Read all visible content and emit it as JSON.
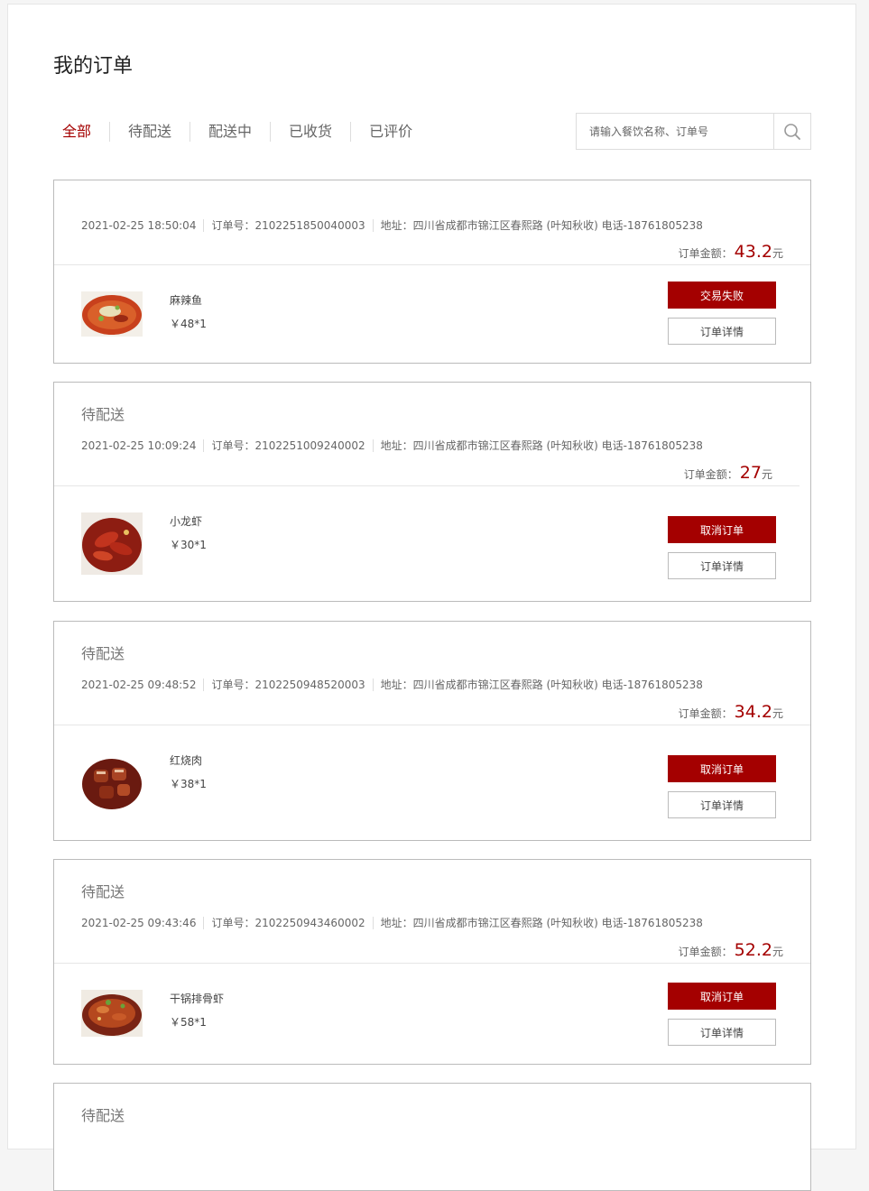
{
  "page": {
    "title": "我的订单"
  },
  "tabs": [
    "全部",
    "待配送",
    "配送中",
    "已收货",
    "已评价"
  ],
  "search": {
    "placeholder": "请输入餐饮名称、订单号",
    "icon": "search-icon"
  },
  "orders": [
    {
      "status": "",
      "datetime": "2021-02-25 18:50:04",
      "order_no": "订单号：2102251850040003",
      "address": "地址：四川省成都市锦江区春熙路 (叶知秋收) 电话-18761805238",
      "total_label": "订单金额：",
      "total": "43.2",
      "unit": "元",
      "item": {
        "name": "麻辣鱼",
        "price": "￥48*1",
        "image": "spicy-fish-dish"
      },
      "primary_button": "交易失败",
      "detail_button": "订单详情"
    },
    {
      "status": "待配送",
      "datetime": "2021-02-25 10:09:24",
      "order_no": "订单号：2102251009240002",
      "address": "地址：四川省成都市锦江区春熙路 (叶知秋收) 电话-18761805238",
      "total_label": "订单金额：",
      "total": "27",
      "unit": "元",
      "item": {
        "name": "小龙虾",
        "price": "￥30*1",
        "image": "crayfish-dish"
      },
      "primary_button": "取消订单",
      "detail_button": "订单详情"
    },
    {
      "status": "待配送",
      "datetime": "2021-02-25 09:48:52",
      "order_no": "订单号：2102250948520003",
      "address": "地址：四川省成都市锦江区春熙路 (叶知秋收) 电话-18761805238",
      "total_label": "订单金额：",
      "total": "34.2",
      "unit": "元",
      "item": {
        "name": "红烧肉",
        "price": "￥38*1",
        "image": "braised-pork-dish"
      },
      "primary_button": "取消订单",
      "detail_button": "订单详情"
    },
    {
      "status": "待配送",
      "datetime": "2021-02-25 09:43:46",
      "order_no": "订单号：2102250943460002",
      "address": "地址：四川省成都市锦江区春熙路 (叶知秋收) 电话-18761805238",
      "total_label": "订单金额：",
      "total": "52.2",
      "unit": "元",
      "item": {
        "name": "干锅排骨虾",
        "price": "￥58*1",
        "image": "dry-pot-rib-shrimp-dish"
      },
      "primary_button": "取消订单",
      "detail_button": "订单详情"
    },
    {
      "status": "待配送"
    }
  ],
  "colors": {
    "accent": "#a40000",
    "border": "#bbbbbb",
    "muted_text": "#666666"
  }
}
